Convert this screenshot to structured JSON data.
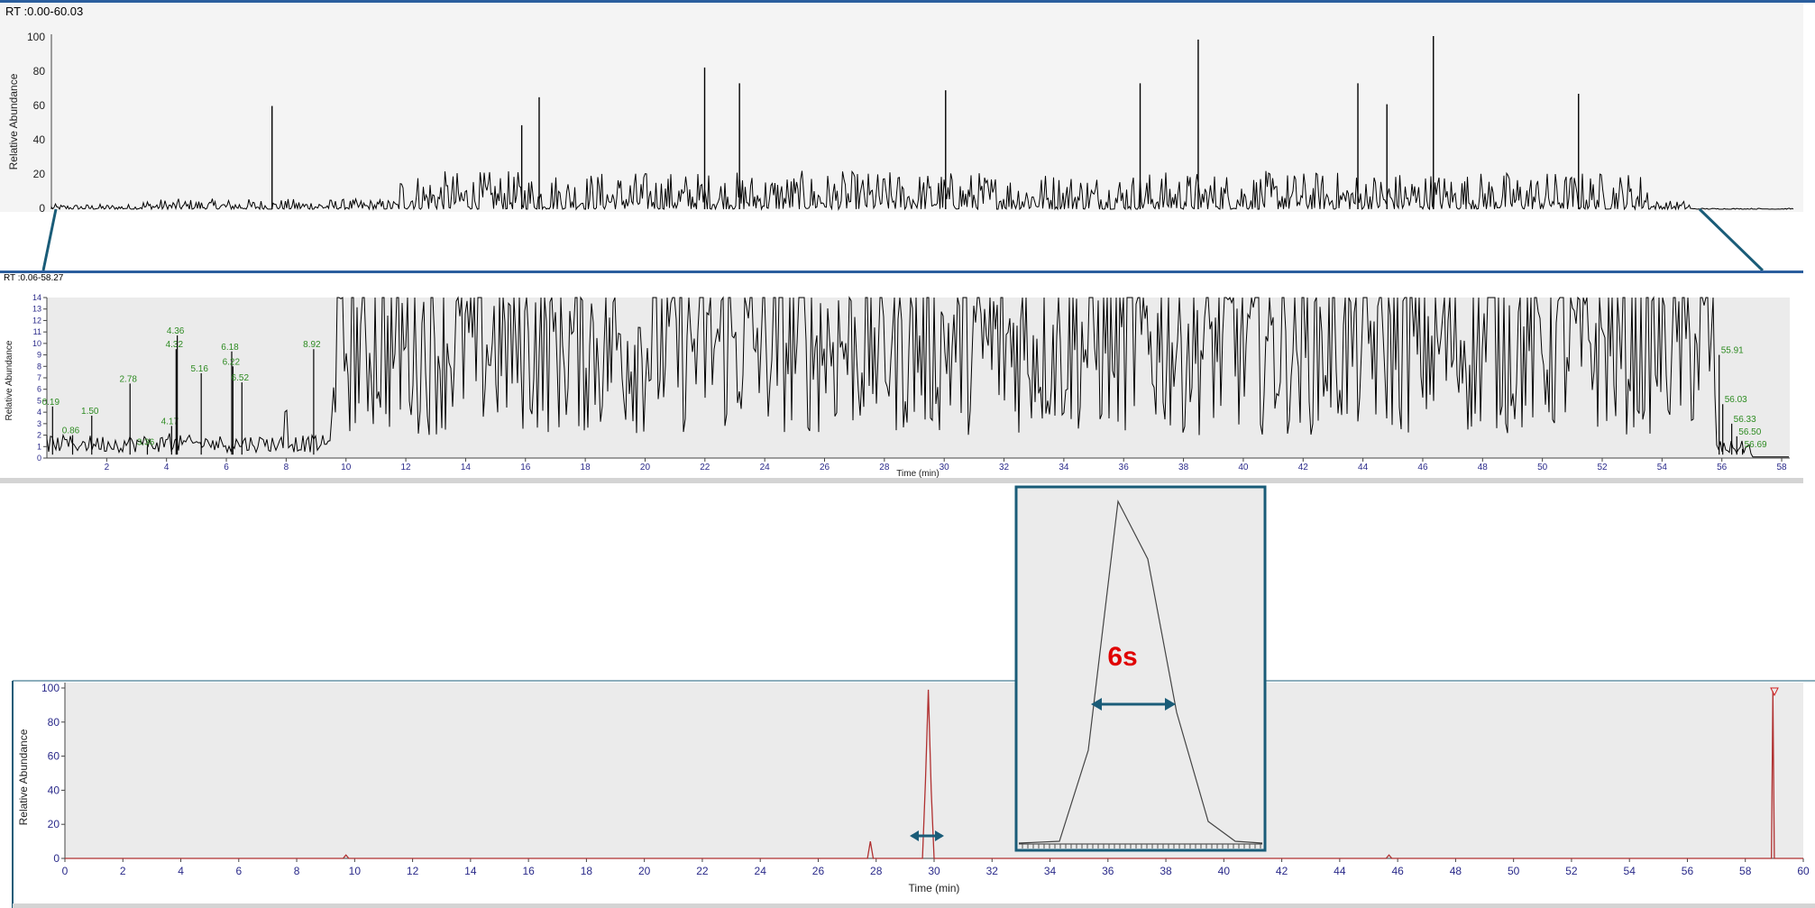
{
  "top_panel": {
    "range_label": "RT :0.00-60.03",
    "ylabel": "Relative Abundance",
    "yticks": [
      "100",
      "80",
      "60",
      "40",
      "20",
      "0"
    ]
  },
  "middle_panel": {
    "range_label": "RT :0.06-58.27",
    "ylabel": "Relative Abundance",
    "xlabel": "Time (min)",
    "yticks": [
      "14",
      "13",
      "12",
      "11",
      "10",
      "9",
      "8",
      "7",
      "6",
      "5",
      "4",
      "3",
      "2",
      "1",
      "0"
    ],
    "xticks": [
      "2",
      "4",
      "6",
      "8",
      "10",
      "12",
      "14",
      "16",
      "18",
      "20",
      "22",
      "24",
      "26",
      "28",
      "30",
      "32",
      "34",
      "36",
      "38",
      "40",
      "42",
      "44",
      "46",
      "48",
      "50",
      "52",
      "54",
      "56",
      "58"
    ]
  },
  "bottom_panel": {
    "ylabel": "Relative Abundance",
    "xlabel": "Time (min)",
    "yticks": [
      "100",
      "80",
      "60",
      "40",
      "20",
      "0"
    ],
    "xticks": [
      "0",
      "2",
      "4",
      "6",
      "8",
      "10",
      "12",
      "14",
      "16",
      "18",
      "20",
      "22",
      "24",
      "26",
      "28",
      "30",
      "32",
      "34",
      "36",
      "38",
      "40",
      "42",
      "44",
      "46",
      "48",
      "50",
      "52",
      "54",
      "56",
      "58",
      "60"
    ]
  },
  "inset": {
    "annotation": "6s"
  },
  "colors": {
    "trace": "#000000",
    "red_trace": "#b03030",
    "peak_label": "#2e8b22",
    "accent": "#1a5c78",
    "axis_text": "#2a2a8a",
    "annotation": "#e00000",
    "panel_bg": "#ebebeb"
  },
  "chart_data": [
    {
      "type": "line",
      "title": "RT :0.00-60.03",
      "ylabel": "Relative Abundance",
      "xlim": [
        0,
        60.03
      ],
      "ylim": [
        0,
        100
      ],
      "peaks": [
        {
          "x": 7.6,
          "y": 59
        },
        {
          "x": 16.2,
          "y": 48
        },
        {
          "x": 16.8,
          "y": 64
        },
        {
          "x": 22.5,
          "y": 81
        },
        {
          "x": 23.7,
          "y": 72
        },
        {
          "x": 30.8,
          "y": 68
        },
        {
          "x": 37.5,
          "y": 72
        },
        {
          "x": 39.5,
          "y": 97
        },
        {
          "x": 45.0,
          "y": 72
        },
        {
          "x": 46.0,
          "y": 60
        },
        {
          "x": 47.6,
          "y": 99
        },
        {
          "x": 52.6,
          "y": 66
        }
      ]
    },
    {
      "type": "line",
      "title": "RT :0.06-58.27",
      "xlabel": "Time (min)",
      "ylabel": "Relative Abundance",
      "xlim": [
        0,
        58.27
      ],
      "ylim": [
        0,
        14
      ],
      "labeled_peaks": [
        {
          "x": 0.19,
          "y": 4.5,
          "label": "0.19"
        },
        {
          "x": 0.86,
          "y": 2.0,
          "label": "0.86"
        },
        {
          "x": 1.5,
          "y": 3.7,
          "label": "1.50"
        },
        {
          "x": 2.78,
          "y": 6.5,
          "label": "2.78"
        },
        {
          "x": 3.36,
          "y": 1.0,
          "label": "3.36"
        },
        {
          "x": 4.17,
          "y": 2.8,
          "label": "4.17"
        },
        {
          "x": 4.32,
          "y": 9.5,
          "label": "4.32"
        },
        {
          "x": 4.36,
          "y": 10.7,
          "label": "4.36"
        },
        {
          "x": 5.16,
          "y": 7.4,
          "label": "5.16"
        },
        {
          "x": 6.18,
          "y": 9.3,
          "label": "6.18"
        },
        {
          "x": 6.22,
          "y": 8.0,
          "label": "6.22"
        },
        {
          "x": 6.52,
          "y": 6.6,
          "label": "6.52"
        },
        {
          "x": 8.92,
          "y": 9.5,
          "label": "8.92"
        },
        {
          "x": 55.91,
          "y": 9.0,
          "label": "55.91"
        },
        {
          "x": 56.03,
          "y": 4.7,
          "label": "56.03"
        },
        {
          "x": 56.33,
          "y": 3.0,
          "label": "56.33"
        },
        {
          "x": 56.5,
          "y": 1.9,
          "label": "56.50"
        },
        {
          "x": 56.69,
          "y": 0.8,
          "label": "56.69"
        }
      ]
    },
    {
      "type": "line",
      "xlabel": "Time (min)",
      "ylabel": "Relative Abundance",
      "xlim": [
        0,
        60
      ],
      "ylim": [
        0,
        100
      ],
      "series": [
        {
          "x": [
            0,
            9.6,
            9.7,
            9.8,
            27.7,
            27.8,
            27.9,
            29.6,
            29.7,
            29.8,
            29.9,
            30.0,
            45.6,
            45.7,
            45.8,
            58.9,
            58.95,
            59.0,
            60
          ],
          "values": [
            0,
            0,
            2,
            0,
            0,
            10,
            0,
            0,
            45,
            99,
            40,
            0,
            0,
            2,
            0,
            0,
            98,
            0,
            0
          ]
        }
      ]
    }
  ]
}
